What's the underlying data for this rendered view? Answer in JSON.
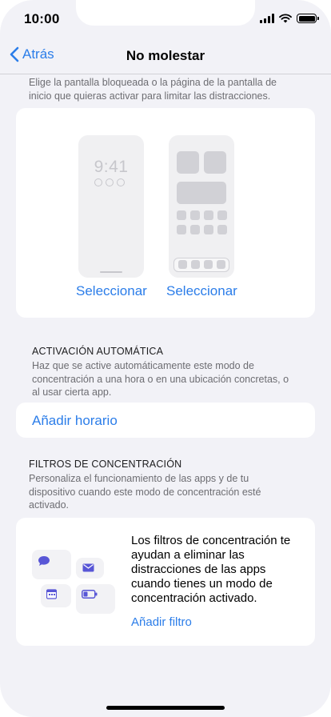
{
  "status_bar": {
    "time": "10:00"
  },
  "nav": {
    "back_label": "Atrás",
    "title": "No molestar"
  },
  "screens": {
    "intro": "Elige la pantalla bloqueada o la página de la pantalla de inicio que quieras activar para limitar las distracciones.",
    "lock_time": "9:41",
    "select_lock_label": "Seleccionar",
    "select_home_label": "Seleccionar"
  },
  "automatic": {
    "header": "ACTIVACIÓN AUTOMÁTICA",
    "description": "Haz que se active automáticamente este modo de concentración a una hora o en una ubicación concretas, o al usar cierta app.",
    "add_schedule_label": "Añadir horario"
  },
  "filters": {
    "header": "FILTROS DE CONCENTRACIÓN",
    "description": "Personaliza el funcionamiento de las apps y de tu dispositivo cuando este modo de concentración esté activado.",
    "card_text": "Los filtros de concentración te ayudan a eliminar las distracciones de las apps cuando tienes un modo de concentración activado.",
    "add_filter_label": "Añadir filtro"
  },
  "colors": {
    "accent": "#2b7de9",
    "illustration": "#5856d6",
    "background": "#f2f2f7"
  }
}
